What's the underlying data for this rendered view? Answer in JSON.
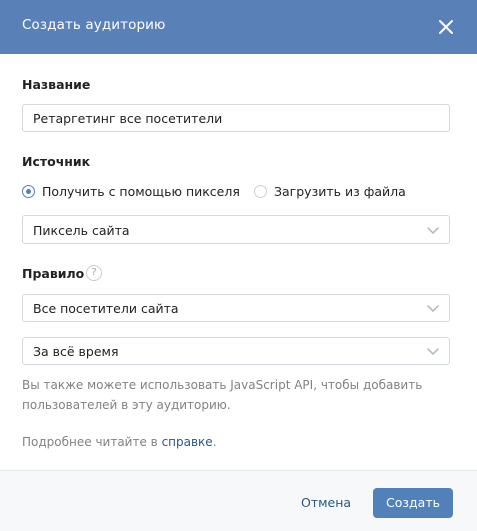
{
  "dialog": {
    "title": "Создать аудиторию",
    "close_icon": "close-icon",
    "header_color": "#5a81b7"
  },
  "name_section": {
    "label": "Название",
    "value": "Ретаргетинг все посетители"
  },
  "source_section": {
    "label": "Источник",
    "options": [
      {
        "label": "Получить с помощью пикселя",
        "selected": true
      },
      {
        "label": "Загрузить из файла",
        "selected": false
      }
    ],
    "pixel_select": "Пиксель сайта"
  },
  "rule_section": {
    "label": "Правило",
    "help_icon": "question-icon",
    "help_glyph": "?",
    "visitors_select": "Все посетители сайта",
    "period_select": "За всё время"
  },
  "notes": {
    "api_line1": "Вы также можете использовать JavaScript API, чтобы добавить",
    "api_line2": "пользователей в эту аудиторию.",
    "more_prefix": "Подробнее читайте в ",
    "more_link": "справке",
    "more_suffix": "."
  },
  "footer": {
    "cancel_label": "Отмена",
    "create_label": "Создать",
    "accent_color": "#5181b8"
  }
}
